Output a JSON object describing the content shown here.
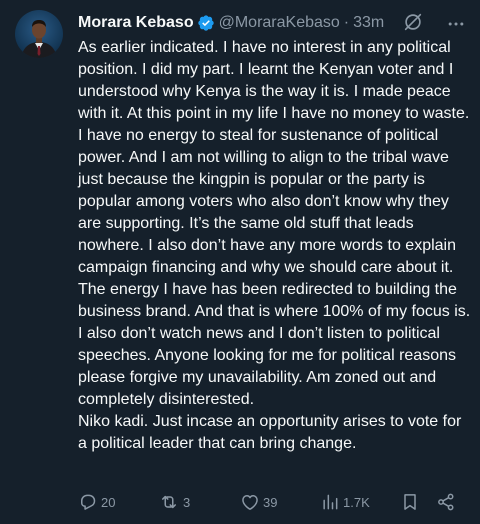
{
  "author": {
    "display_name": "Morara Kebaso",
    "handle": "@MoraraKebaso",
    "separator": "·",
    "time": "33m"
  },
  "tweet": {
    "paragraphs": [
      "As earlier indicated. I have no interest in any political position. I did my part. I learnt the Kenyan voter and I understood why Kenya is the way it is. I made peace with it. At this point in my life I have no money to waste. I have no energy to steal for sustenance of political power. And I am not willing to align to the tribal wave just because the kingpin is popular or the party is popular among voters who also don’t know why they are supporting. It’s the same old stuff that leads nowhere. I also don’t have any more words to explain campaign financing and why we should care about it.",
      "The energy I have has been redirected to building the business brand. And that is where 100% of my focus is.",
      "I also don’t watch news and I don’t listen to political speeches. Anyone looking for me for political reasons please forgive my unavailability. Am zoned out and completely disinterested.",
      "Niko kadi. Just incase an opportunity arises to vote for a political leader that can bring change."
    ]
  },
  "actions": {
    "replies": "20",
    "reposts": "3",
    "likes": "39",
    "views": "1.7K"
  },
  "icons": {
    "verified": "verified-badge-icon",
    "grok": "grok-icon",
    "more": "more-icon",
    "reply": "reply-icon",
    "repost": "repost-icon",
    "like": "like-icon",
    "views": "views-icon",
    "bookmark": "bookmark-icon",
    "share": "share-icon"
  },
  "colors": {
    "background": "#15202b",
    "text": "#f7f9f9",
    "muted": "#8b98a5",
    "verified": "#1d9bf0"
  }
}
